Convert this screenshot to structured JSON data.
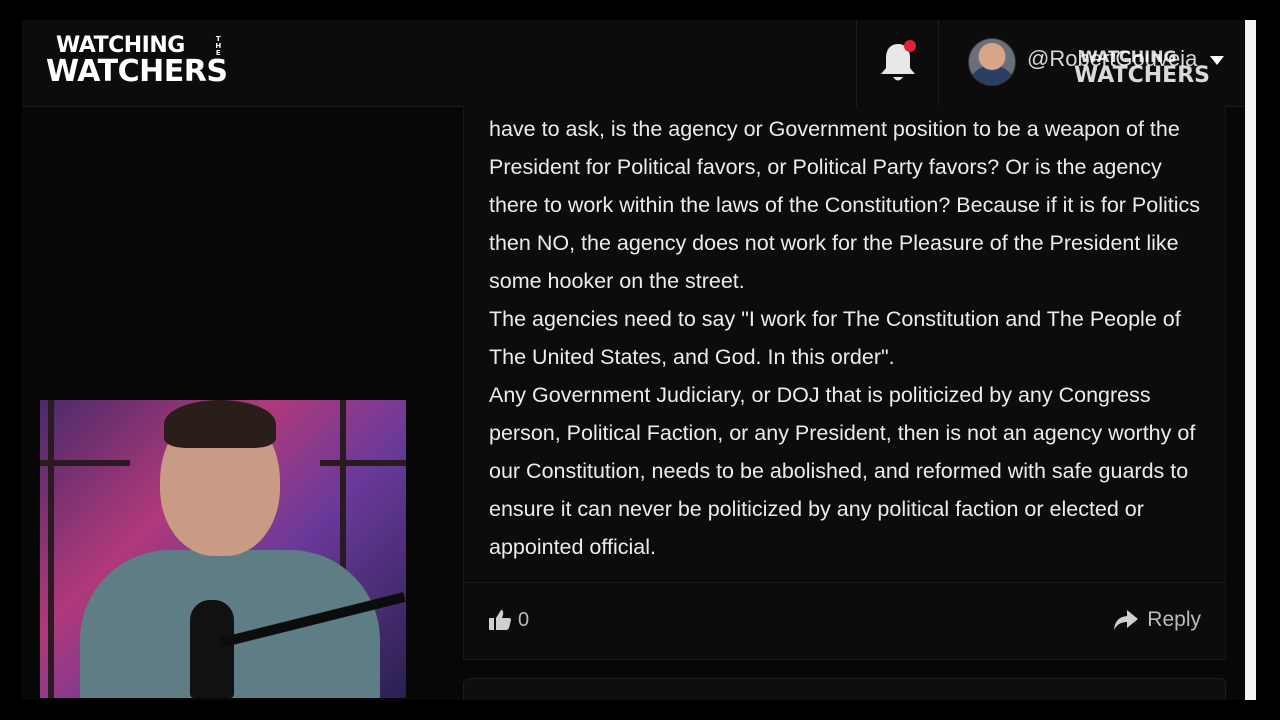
{
  "header": {
    "logo_line1": "WATCHING",
    "logo_the": "THE",
    "logo_line2": "WATCHERS",
    "username": "@RobertGouveia",
    "watermark_line1": "WATCHING",
    "watermark_line2": "WATCHERS",
    "icons": {
      "notification": "bell-icon",
      "menu": "chevron-down-icon"
    },
    "notification_dot_color": "#e0203a"
  },
  "comment": {
    "paragraphs": [
      "have to ask, is the agency or Government position to be a weapon of the President for Political favors, or Political Party favors? Or is the agency there to work within the laws of the Constitution? Because if it is for Politics then NO, the agency does not work for the Pleasure of the President like some hooker on the street.",
      "The agencies need to say \"I work for The Constitution and The People of The United States, and God. In this order\".",
      "Any Government Judiciary, or DOJ that is politicized by any Congress person, Political Faction, or any President, then is not an agency worthy of our Constitution, needs to be abolished, and reformed with safe guards to ensure it can never be politicized by any political faction or elected or appointed official."
    ],
    "like_count": "0",
    "reply_label": "Reply",
    "icons": {
      "like": "thumbs-up-icon",
      "reply": "reply-arrow-icon"
    }
  }
}
